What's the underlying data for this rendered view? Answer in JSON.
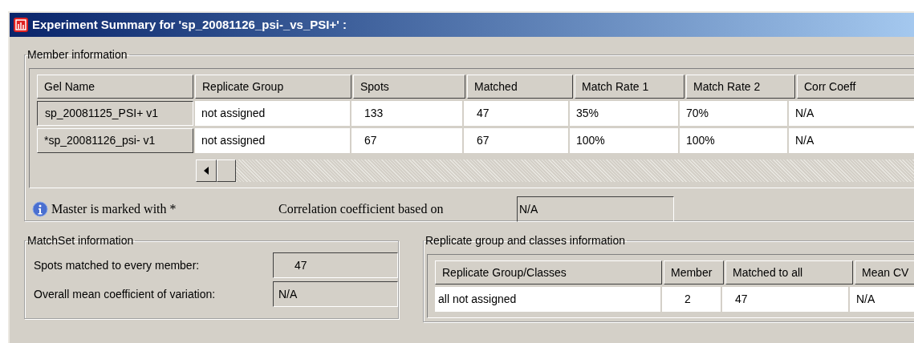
{
  "window": {
    "title": "Experiment Summary for 'sp_20081126_psi-_vs_PSI+' :"
  },
  "member_information": {
    "title": "Member information",
    "columns": [
      "Gel Name",
      "Replicate Group",
      "Spots",
      "Matched",
      "Match Rate 1",
      "Match Rate 2",
      "Corr Coeff"
    ],
    "rows": [
      {
        "selected": true,
        "cells": [
          "sp_20081125_PSI+ v1",
          "not assigned",
          "133",
          "47",
          "35%",
          "70%",
          "N/A"
        ]
      },
      {
        "selected": false,
        "cells": [
          "*sp_20081126_psi- v1",
          "not assigned",
          "67",
          "67",
          "100%",
          "100%",
          "N/A"
        ]
      }
    ],
    "note": "Master is marked with *",
    "correlation_label": "Correlation coefficient based on",
    "correlation_value": "N/A"
  },
  "matchset_information": {
    "title": "MatchSet information",
    "fields": [
      {
        "label": "Spots matched to every member:",
        "value": "47"
      },
      {
        "label": "Overall mean coefficient of variation:",
        "value": "N/A"
      }
    ]
  },
  "replicate_information": {
    "title": "Replicate group and classes information",
    "columns": [
      "Replicate Group/Classes",
      "Member",
      "Matched to all",
      "Mean CV"
    ],
    "rows": [
      [
        "all not assigned",
        "2",
        "47",
        "N/A"
      ]
    ]
  }
}
